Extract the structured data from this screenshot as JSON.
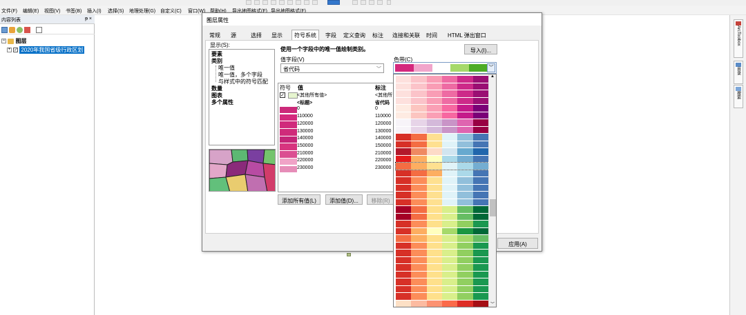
{
  "menubar": {
    "items": [
      "文件(F)",
      "编辑(E)",
      "视图(V)",
      "书签(B)",
      "插入(I)",
      "选择(S)",
      "地理处理(G)",
      "自定义(C)",
      "窗口(W)",
      "帮助(H)",
      "导出地图格式(F)",
      "导出地图格式(F)"
    ]
  },
  "toc": {
    "title": "内容列表",
    "layers_label": "图层",
    "layer_name": "2020年我国省级行政区划",
    "pin_symbol": "ᵽ ×"
  },
  "rightbar": {
    "tabs": [
      "ArcToolbox",
      "目录",
      "搜索"
    ]
  },
  "dialog": {
    "title": "图层属性",
    "tabs": [
      "常规",
      "源",
      "选择",
      "显示",
      "符号系统",
      "字段",
      "定义查询",
      "标注",
      "连接和关联",
      "时间",
      "HTML 弹出窗口"
    ],
    "active_tab": "符号系统",
    "show_label": "显示(S):",
    "show_items": [
      {
        "label": "要素",
        "bold": true
      },
      {
        "label": "类别",
        "bold": true
      },
      {
        "label": "唯一值",
        "bold": false
      },
      {
        "label": "唯一值，多个字段",
        "bold": false
      },
      {
        "label": "与样式中的符号匹配",
        "bold": false
      },
      {
        "label": "数量",
        "bold": true
      },
      {
        "label": "图表",
        "bold": true
      },
      {
        "label": "多个属性",
        "bold": true
      }
    ],
    "description": "使用一个字段中的唯一值绘制类别。",
    "import_button": "导入(I)...",
    "value_field_label": "值字段(V)",
    "value_field": "省代码",
    "color_ramp_label": "色带(C)",
    "table_headers": {
      "symbol": "符号",
      "value": "值",
      "label": "标注"
    },
    "rows": [
      {
        "value": "<其他所有值>",
        "label": "<其他所",
        "color": "#e6f5cf",
        "bold": false
      },
      {
        "value": "<标题>",
        "label": "省代码",
        "color": "",
        "bold": true
      },
      {
        "value": "0",
        "label": "0",
        "color": "#cc2a7a"
      },
      {
        "value": "110000",
        "label": "110000",
        "color": "#d42a7d"
      },
      {
        "value": "120000",
        "label": "120000",
        "color": "#d02a7c"
      },
      {
        "value": "130000",
        "label": "130000",
        "color": "#cf2a7a"
      },
      {
        "value": "140000",
        "label": "140000",
        "color": "#c42578"
      },
      {
        "value": "150000",
        "label": "150000",
        "color": "#d7347f"
      },
      {
        "value": "210000",
        "label": "210000",
        "color": "#db4e91"
      },
      {
        "value": "220000",
        "label": "220000",
        "color": "#f0a3c7"
      },
      {
        "value": "230000",
        "label": "230000",
        "color": "#e68db8"
      }
    ],
    "add_all_button": "添加所有值(L)",
    "add_value_button": "添加值(D)...",
    "remove_button": "移除(R)",
    "apply_button": "应用(A)"
  },
  "ramp_selected": [
    "#d4287d",
    "#f1a5cb",
    "#ffffff",
    "#a6d96a",
    "#4dac26"
  ],
  "ramps": [
    [
      "#fde0dd",
      "#fbc3c9",
      "#f99db5",
      "#ee6ba3",
      "#cd2a89",
      "#9a0f73"
    ],
    [
      "#fde0dd",
      "#fbc3c9",
      "#f99db5",
      "#ee6ba3",
      "#cd2a89",
      "#9a0f73"
    ],
    [
      "#fde0dd",
      "#fbc3c9",
      "#f99db5",
      "#ee6ba3",
      "#cd2a89",
      "#9a0f73"
    ],
    [
      "#fde0dd",
      "#fbc3c9",
      "#f99db5",
      "#ee6ba3",
      "#cd2a89",
      "#9a0f73"
    ],
    [
      "#feebe2",
      "#fcc5c0",
      "#fa9fb5",
      "#f768a1",
      "#c51b8a",
      "#7a0177"
    ],
    [
      "#feebe2",
      "#fcc5c0",
      "#fa9fb5",
      "#f768a1",
      "#c51b8a",
      "#7a0177"
    ],
    [
      "#f7f4f9",
      "#e7d4e8",
      "#d4b9da",
      "#c994c7",
      "#df65b0",
      "#980043"
    ],
    [
      "#f7f4f9",
      "#e7d4e8",
      "#d4b9da",
      "#c994c7",
      "#df65b0",
      "#980043"
    ],
    [
      "#d73027",
      "#f46d43",
      "#fee090",
      "#e0f3f8",
      "#91bfdb",
      "#4575b4"
    ],
    [
      "#d73027",
      "#f46d43",
      "#fee090",
      "#e0f3f8",
      "#91bfdb",
      "#4575b4"
    ],
    [
      "#b2182b",
      "#ef8a62",
      "#fddbc7",
      "#d1e5f0",
      "#67a9cf",
      "#2166ac"
    ],
    [
      "#e31a1c",
      "#fdae61",
      "#ffffbf",
      "#abd9e9",
      "#74add1",
      "#4575b4"
    ],
    [
      "#f46d43",
      "#fdae61",
      "#fee090",
      "#e0f3f8",
      "#abd9e9",
      "#74add1"
    ],
    [
      "#d73027",
      "#f46d43",
      "#fdae61",
      "#e0f3f8",
      "#abd9e9",
      "#4575b4"
    ],
    [
      "#d73027",
      "#fc8d59",
      "#fee090",
      "#e0f3f8",
      "#91bfdb",
      "#4575b4"
    ],
    [
      "#d73027",
      "#fc8d59",
      "#fee090",
      "#e0f3f8",
      "#91bfdb",
      "#4575b4"
    ],
    [
      "#d73027",
      "#fc8d59",
      "#fee090",
      "#e0f3f8",
      "#91bfdb",
      "#4575b4"
    ],
    [
      "#d73027",
      "#fc8d59",
      "#fee090",
      "#e0f3f8",
      "#91bfdb",
      "#4575b4"
    ],
    [
      "#a50026",
      "#f46d43",
      "#fee08b",
      "#d9ef8b",
      "#66bd63",
      "#006837"
    ],
    [
      "#a50026",
      "#f46d43",
      "#fee08b",
      "#d9ef8b",
      "#66bd63",
      "#006837"
    ],
    [
      "#d73027",
      "#fc8d59",
      "#fee08b",
      "#d9ef8b",
      "#91cf60",
      "#1a9850"
    ],
    [
      "#d73027",
      "#fdae61",
      "#ffffbf",
      "#a6d96a",
      "#1a9641",
      "#006837"
    ],
    [
      "#f46d43",
      "#fdae61",
      "#fee08b",
      "#d9ef8b",
      "#a6d96a",
      "#66bd63"
    ],
    [
      "#d73027",
      "#fc8d59",
      "#fee08b",
      "#d9ef8b",
      "#91cf60",
      "#1a9850"
    ],
    [
      "#d73027",
      "#fc8d59",
      "#fee08b",
      "#d9ef8b",
      "#91cf60",
      "#1a9850"
    ],
    [
      "#d73027",
      "#fc8d59",
      "#fee08b",
      "#d9ef8b",
      "#91cf60",
      "#1a9850"
    ],
    [
      "#d73027",
      "#fc8d59",
      "#fee08b",
      "#d9ef8b",
      "#91cf60",
      "#1a9850"
    ],
    [
      "#d73027",
      "#fc8d59",
      "#fee08b",
      "#d9ef8b",
      "#91cf60",
      "#1a9850"
    ],
    [
      "#d73027",
      "#fc8d59",
      "#fee08b",
      "#d9ef8b",
      "#91cf60",
      "#1a9850"
    ],
    [
      "#d73027",
      "#fc8d59",
      "#fee08b",
      "#d9ef8b",
      "#91cf60",
      "#1a9850"
    ],
    [
      "#d73027",
      "#fc8d59",
      "#fee08b",
      "#d9ef8b",
      "#91cf60",
      "#1a9850"
    ],
    [
      "#fde0c5",
      "#fcbba1",
      "#fc9272",
      "#fb6a4a",
      "#de2d26",
      "#a50f15"
    ]
  ]
}
